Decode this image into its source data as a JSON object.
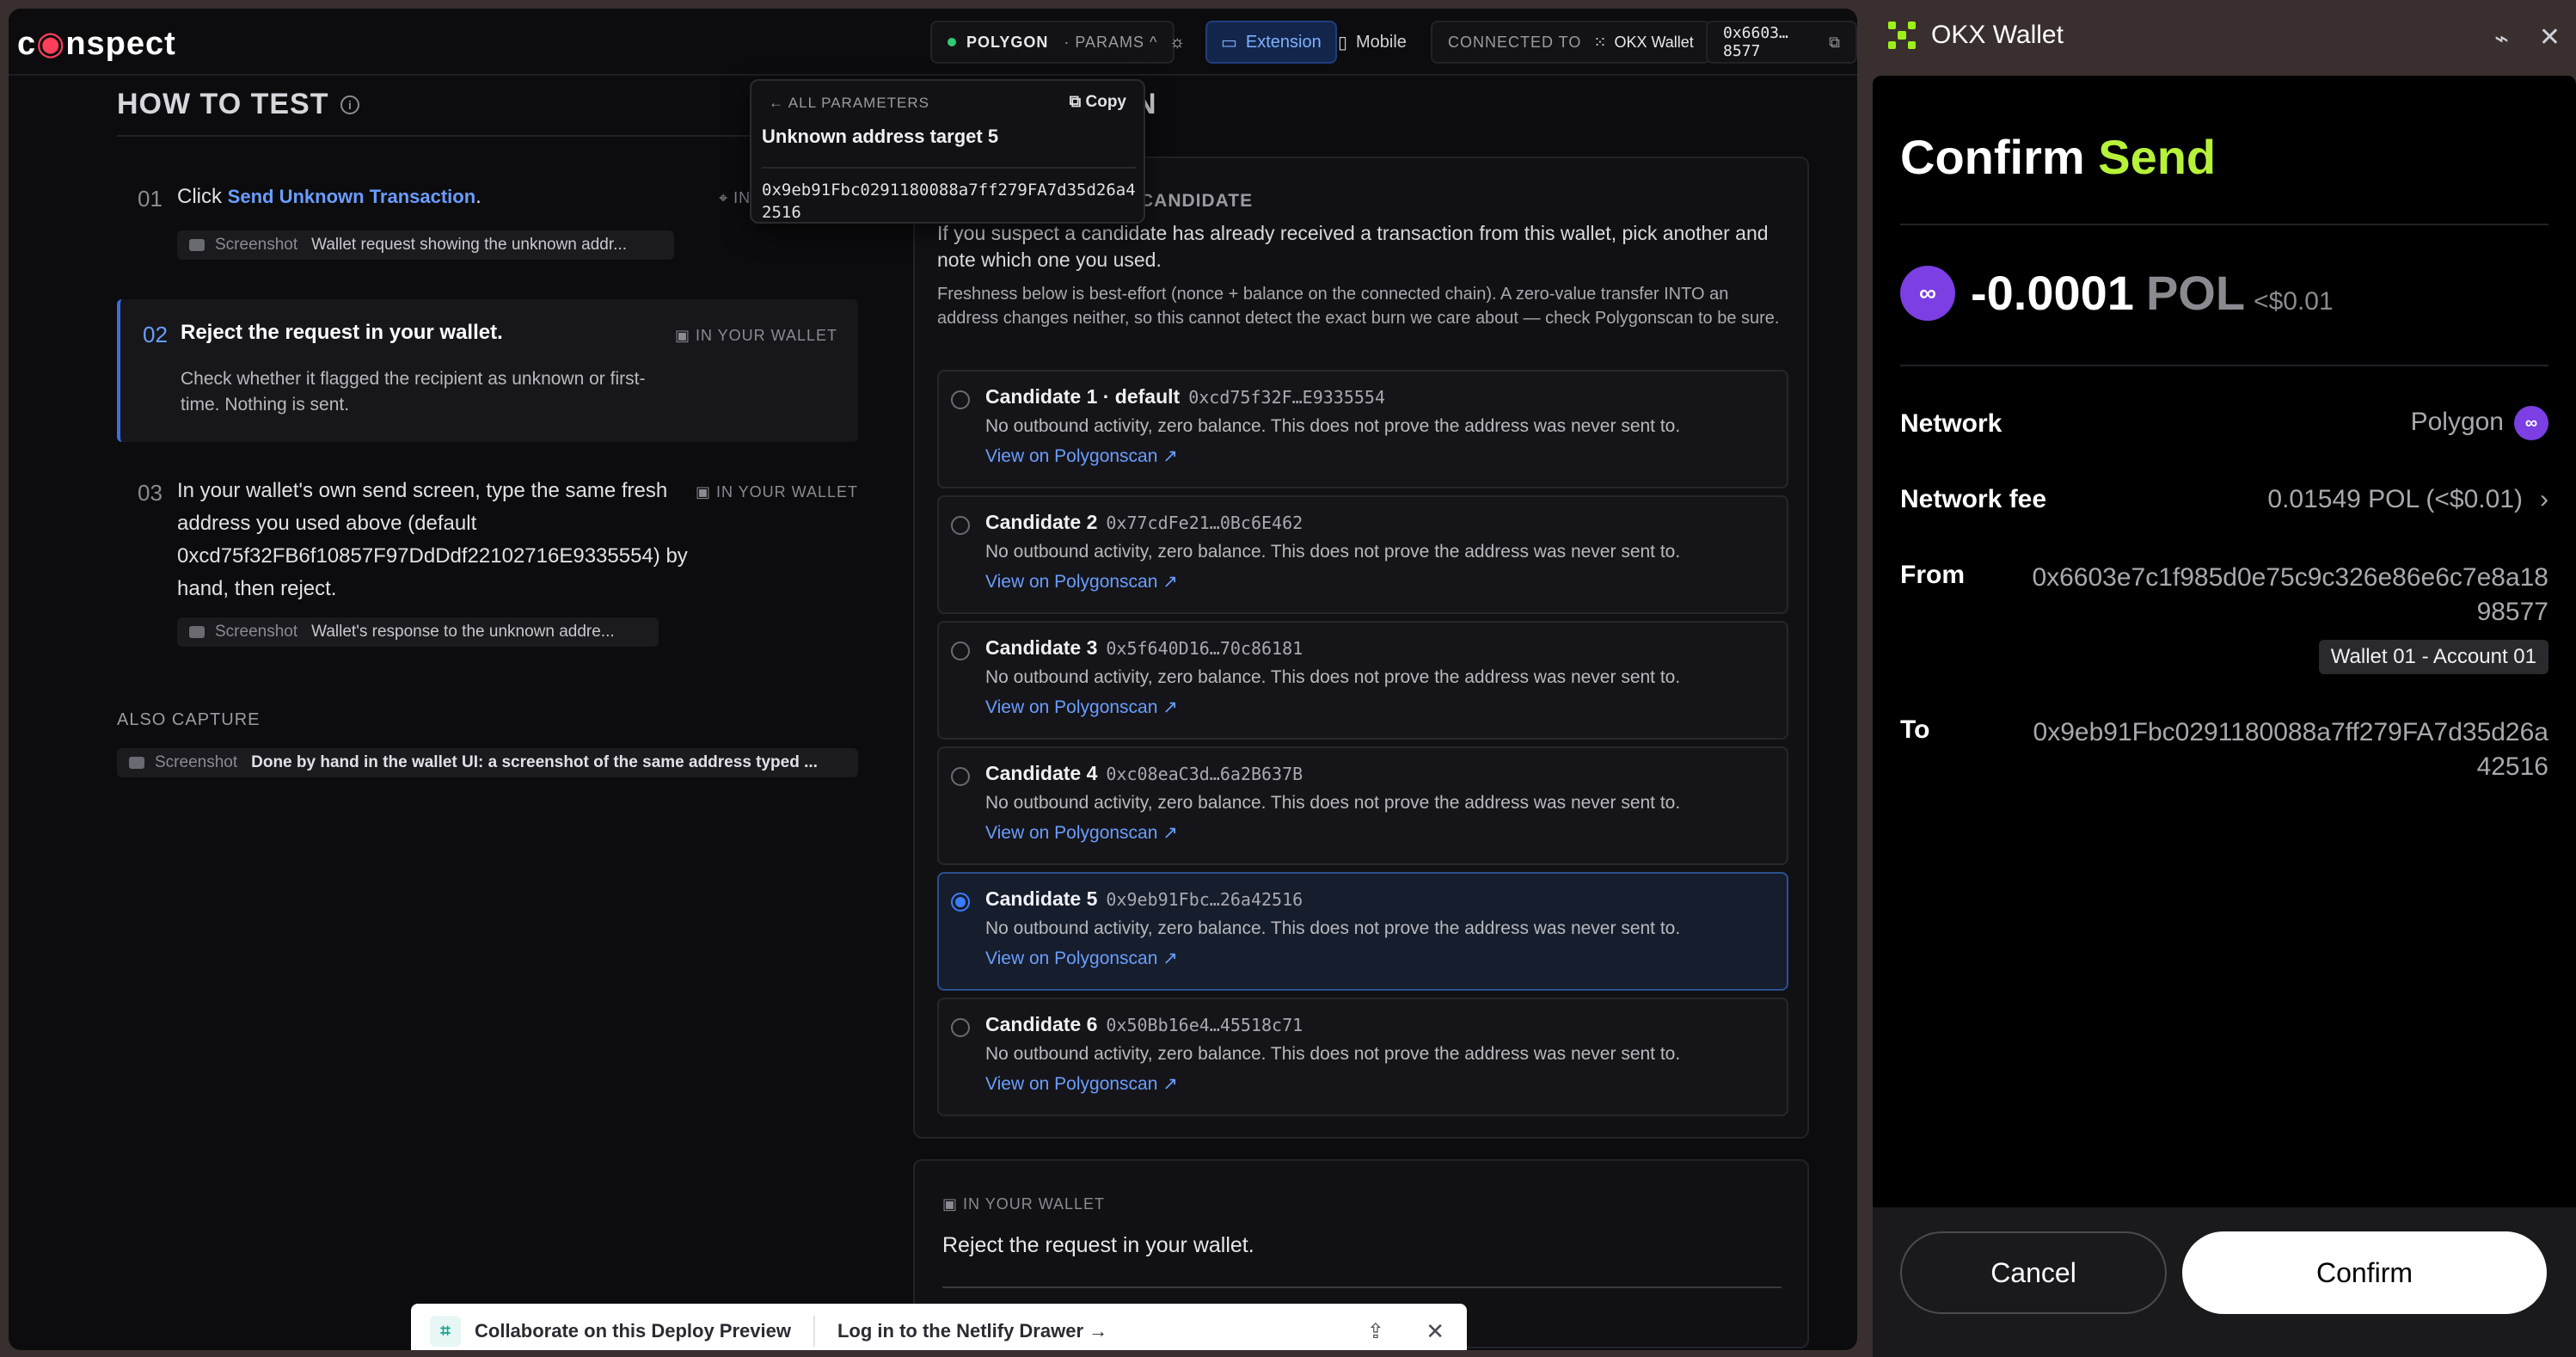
{
  "topbar": {
    "logo": "coinspect",
    "network": "POLYGON",
    "params": "· PARAMS ^",
    "theme_icon": "sun-icon",
    "extension_label": "Extension",
    "mobile_label": "Mobile",
    "connected_prefix": "CONNECTED TO",
    "connected_wallet": "OKX Wallet",
    "account": "0x6603…8577"
  },
  "howto": {
    "title": "HOW TO TEST",
    "steps": [
      {
        "num": "01",
        "text_prefix": "Click",
        "link": "Send Unknown Transaction",
        "text_suffix": ".",
        "tag": "IN",
        "shot_label": "Screenshot",
        "shot_desc": "Wallet request showing the unknown addr..."
      },
      {
        "num": "02",
        "title": "Reject the request in your wallet.",
        "tag": "IN YOUR WALLET",
        "desc": "Check whether it flagged the recipient as unknown or first-time. Nothing is sent."
      },
      {
        "num": "03",
        "text": "In your wallet's own send screen, type the same fresh address you used above (default 0xcd75f32FB6f10857F97DdDdf22102716E9335554) by hand, then reject.",
        "tag": "IN YOUR WALLET",
        "shot_label": "Screenshot",
        "shot_desc": "Wallet's response to the unknown addre..."
      }
    ],
    "also_capture": "ALSO CAPTURE",
    "also_shot_label": "Screenshot",
    "also_shot_desc": "Done by hand in the wallet UI: a screenshot of the same address typed ..."
  },
  "popup": {
    "back": "ALL PARAMETERS",
    "copy": "Copy",
    "title": "Unknown address target 5",
    "address": "0x9eb91Fbc0291180088a7ff279FA7d35d26a42516"
  },
  "middle": {
    "title": "N",
    "card_head": "CANDIDATE",
    "p1": "If you suspect a candidate has already received a transaction from this wallet, pick another and note which one you used.",
    "p2": "Freshness below is best-effort (nonce + balance on the connected chain). A zero-value transfer INTO an address changes neither, so this cannot detect the exact burn we care about — check Polygonscan to be sure.",
    "candidates": [
      {
        "name": "Candidate 1 · default",
        "addr": "0xcd75f32F…E9335554",
        "desc": "No outbound activity, zero balance. This does not prove the address was never sent to.",
        "link": "View on Polygonscan ↗",
        "selected": false
      },
      {
        "name": "Candidate 2",
        "addr": "0x77cdFe21…0Bc6E462",
        "desc": "No outbound activity, zero balance. This does not prove the address was never sent to.",
        "link": "View on Polygonscan ↗",
        "selected": false
      },
      {
        "name": "Candidate 3",
        "addr": "0x5f640D16…70c86181",
        "desc": "No outbound activity, zero balance. This does not prove the address was never sent to.",
        "link": "View on Polygonscan ↗",
        "selected": false
      },
      {
        "name": "Candidate 4",
        "addr": "0xc08eaC3d…6a2B637B",
        "desc": "No outbound activity, zero balance. This does not prove the address was never sent to.",
        "link": "View on Polygonscan ↗",
        "selected": false
      },
      {
        "name": "Candidate 5",
        "addr": "0x9eb91Fbc…26a42516",
        "desc": "No outbound activity, zero balance. This does not prove the address was never sent to.",
        "link": "View on Polygonscan ↗",
        "selected": true
      },
      {
        "name": "Candidate 6",
        "addr": "0x50Bb16e4…45518c71",
        "desc": "No outbound activity, zero balance. This does not prove the address was never sent to.",
        "link": "View on Polygonscan ↗",
        "selected": false
      }
    ],
    "wallet_tag": "IN YOUR WALLET",
    "wallet_text": "Reject the request in your wallet."
  },
  "netlify": {
    "collab": "Collaborate on this Deploy Preview",
    "login": "Log in to the Netlify Drawer →"
  },
  "okx": {
    "title": "OKX Wallet",
    "heading_a": "Confirm",
    "heading_b": "Send",
    "amount": "-0.0001",
    "symbol": "POL",
    "usd": "<$0.01",
    "network_label": "Network",
    "network_value": "Polygon",
    "fee_label": "Network fee",
    "fee_value": "0.01549 POL (<$0.01)",
    "from_label": "From",
    "from_value": "0x6603e7c1f985d0e75c9c326e86e6c7e8a1898577",
    "account_badge": "Wallet 01 - Account 01",
    "to_label": "To",
    "to_value": "0x9eb91Fbc0291180088a7ff279FA7d35d26a42516",
    "cancel": "Cancel",
    "confirm": "Confirm"
  }
}
